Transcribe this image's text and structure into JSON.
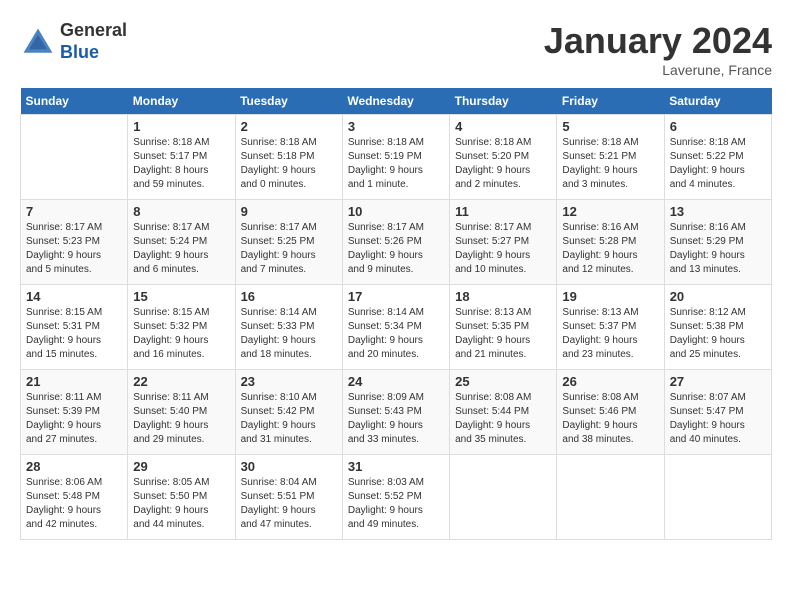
{
  "header": {
    "logo_general": "General",
    "logo_blue": "Blue",
    "month_title": "January 2024",
    "location": "Laverune, France"
  },
  "days_of_week": [
    "Sunday",
    "Monday",
    "Tuesday",
    "Wednesday",
    "Thursday",
    "Friday",
    "Saturday"
  ],
  "weeks": [
    [
      {
        "day": "",
        "info": ""
      },
      {
        "day": "1",
        "info": "Sunrise: 8:18 AM\nSunset: 5:17 PM\nDaylight: 8 hours\nand 59 minutes."
      },
      {
        "day": "2",
        "info": "Sunrise: 8:18 AM\nSunset: 5:18 PM\nDaylight: 9 hours\nand 0 minutes."
      },
      {
        "day": "3",
        "info": "Sunrise: 8:18 AM\nSunset: 5:19 PM\nDaylight: 9 hours\nand 1 minute."
      },
      {
        "day": "4",
        "info": "Sunrise: 8:18 AM\nSunset: 5:20 PM\nDaylight: 9 hours\nand 2 minutes."
      },
      {
        "day": "5",
        "info": "Sunrise: 8:18 AM\nSunset: 5:21 PM\nDaylight: 9 hours\nand 3 minutes."
      },
      {
        "day": "6",
        "info": "Sunrise: 8:18 AM\nSunset: 5:22 PM\nDaylight: 9 hours\nand 4 minutes."
      }
    ],
    [
      {
        "day": "7",
        "info": "Sunrise: 8:17 AM\nSunset: 5:23 PM\nDaylight: 9 hours\nand 5 minutes."
      },
      {
        "day": "8",
        "info": "Sunrise: 8:17 AM\nSunset: 5:24 PM\nDaylight: 9 hours\nand 6 minutes."
      },
      {
        "day": "9",
        "info": "Sunrise: 8:17 AM\nSunset: 5:25 PM\nDaylight: 9 hours\nand 7 minutes."
      },
      {
        "day": "10",
        "info": "Sunrise: 8:17 AM\nSunset: 5:26 PM\nDaylight: 9 hours\nand 9 minutes."
      },
      {
        "day": "11",
        "info": "Sunrise: 8:17 AM\nSunset: 5:27 PM\nDaylight: 9 hours\nand 10 minutes."
      },
      {
        "day": "12",
        "info": "Sunrise: 8:16 AM\nSunset: 5:28 PM\nDaylight: 9 hours\nand 12 minutes."
      },
      {
        "day": "13",
        "info": "Sunrise: 8:16 AM\nSunset: 5:29 PM\nDaylight: 9 hours\nand 13 minutes."
      }
    ],
    [
      {
        "day": "14",
        "info": "Sunrise: 8:15 AM\nSunset: 5:31 PM\nDaylight: 9 hours\nand 15 minutes."
      },
      {
        "day": "15",
        "info": "Sunrise: 8:15 AM\nSunset: 5:32 PM\nDaylight: 9 hours\nand 16 minutes."
      },
      {
        "day": "16",
        "info": "Sunrise: 8:14 AM\nSunset: 5:33 PM\nDaylight: 9 hours\nand 18 minutes."
      },
      {
        "day": "17",
        "info": "Sunrise: 8:14 AM\nSunset: 5:34 PM\nDaylight: 9 hours\nand 20 minutes."
      },
      {
        "day": "18",
        "info": "Sunrise: 8:13 AM\nSunset: 5:35 PM\nDaylight: 9 hours\nand 21 minutes."
      },
      {
        "day": "19",
        "info": "Sunrise: 8:13 AM\nSunset: 5:37 PM\nDaylight: 9 hours\nand 23 minutes."
      },
      {
        "day": "20",
        "info": "Sunrise: 8:12 AM\nSunset: 5:38 PM\nDaylight: 9 hours\nand 25 minutes."
      }
    ],
    [
      {
        "day": "21",
        "info": "Sunrise: 8:11 AM\nSunset: 5:39 PM\nDaylight: 9 hours\nand 27 minutes."
      },
      {
        "day": "22",
        "info": "Sunrise: 8:11 AM\nSunset: 5:40 PM\nDaylight: 9 hours\nand 29 minutes."
      },
      {
        "day": "23",
        "info": "Sunrise: 8:10 AM\nSunset: 5:42 PM\nDaylight: 9 hours\nand 31 minutes."
      },
      {
        "day": "24",
        "info": "Sunrise: 8:09 AM\nSunset: 5:43 PM\nDaylight: 9 hours\nand 33 minutes."
      },
      {
        "day": "25",
        "info": "Sunrise: 8:08 AM\nSunset: 5:44 PM\nDaylight: 9 hours\nand 35 minutes."
      },
      {
        "day": "26",
        "info": "Sunrise: 8:08 AM\nSunset: 5:46 PM\nDaylight: 9 hours\nand 38 minutes."
      },
      {
        "day": "27",
        "info": "Sunrise: 8:07 AM\nSunset: 5:47 PM\nDaylight: 9 hours\nand 40 minutes."
      }
    ],
    [
      {
        "day": "28",
        "info": "Sunrise: 8:06 AM\nSunset: 5:48 PM\nDaylight: 9 hours\nand 42 minutes."
      },
      {
        "day": "29",
        "info": "Sunrise: 8:05 AM\nSunset: 5:50 PM\nDaylight: 9 hours\nand 44 minutes."
      },
      {
        "day": "30",
        "info": "Sunrise: 8:04 AM\nSunset: 5:51 PM\nDaylight: 9 hours\nand 47 minutes."
      },
      {
        "day": "31",
        "info": "Sunrise: 8:03 AM\nSunset: 5:52 PM\nDaylight: 9 hours\nand 49 minutes."
      },
      {
        "day": "",
        "info": ""
      },
      {
        "day": "",
        "info": ""
      },
      {
        "day": "",
        "info": ""
      }
    ]
  ]
}
